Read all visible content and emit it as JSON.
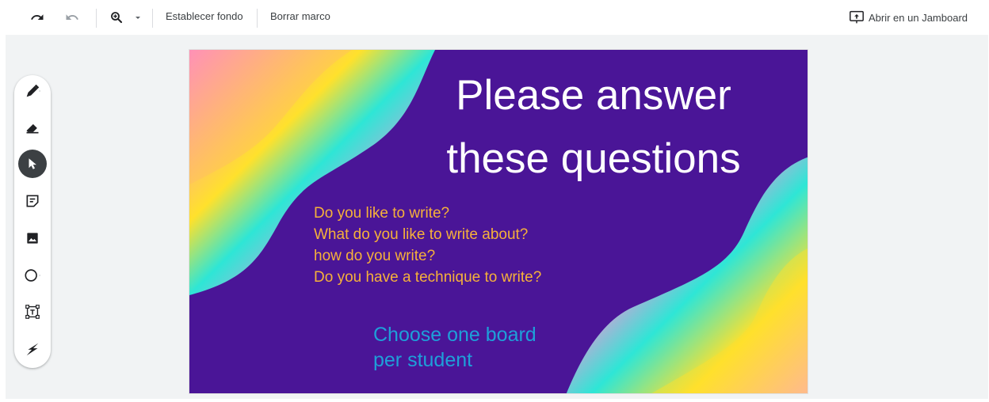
{
  "toolbar": {
    "undo_icon": "undo-icon",
    "redo_icon": "redo-icon",
    "zoom_icon": "zoom-in-icon",
    "zoom_menu_icon": "caret-down-icon",
    "set_background": "Establecer fondo",
    "clear_frame": "Borrar marco",
    "open_in_jamboard": "Abrir en un Jamboard"
  },
  "tools": [
    {
      "name": "pen-icon",
      "active": false
    },
    {
      "name": "eraser-icon",
      "active": false
    },
    {
      "name": "select-icon",
      "active": true
    },
    {
      "name": "sticky-note-icon",
      "active": false
    },
    {
      "name": "image-icon",
      "active": false
    },
    {
      "name": "circle-icon",
      "active": false
    },
    {
      "name": "text-box-icon",
      "active": false
    },
    {
      "name": "laser-icon",
      "active": false
    }
  ],
  "frame": {
    "title_line1": "Please answer",
    "title_line2": "these questions",
    "questions": [
      "Do you like to write?",
      "What do you like to write about?",
      "how do you write?",
      "Do you have a technique to write?"
    ],
    "note_line1": "Choose one board",
    "note_line2": "per student"
  },
  "colors": {
    "frame_background": "#4a1597",
    "title": "#ffffff",
    "questions": "#f6b13a",
    "note": "#1ea0d9",
    "active_tool": "#3c4043"
  }
}
